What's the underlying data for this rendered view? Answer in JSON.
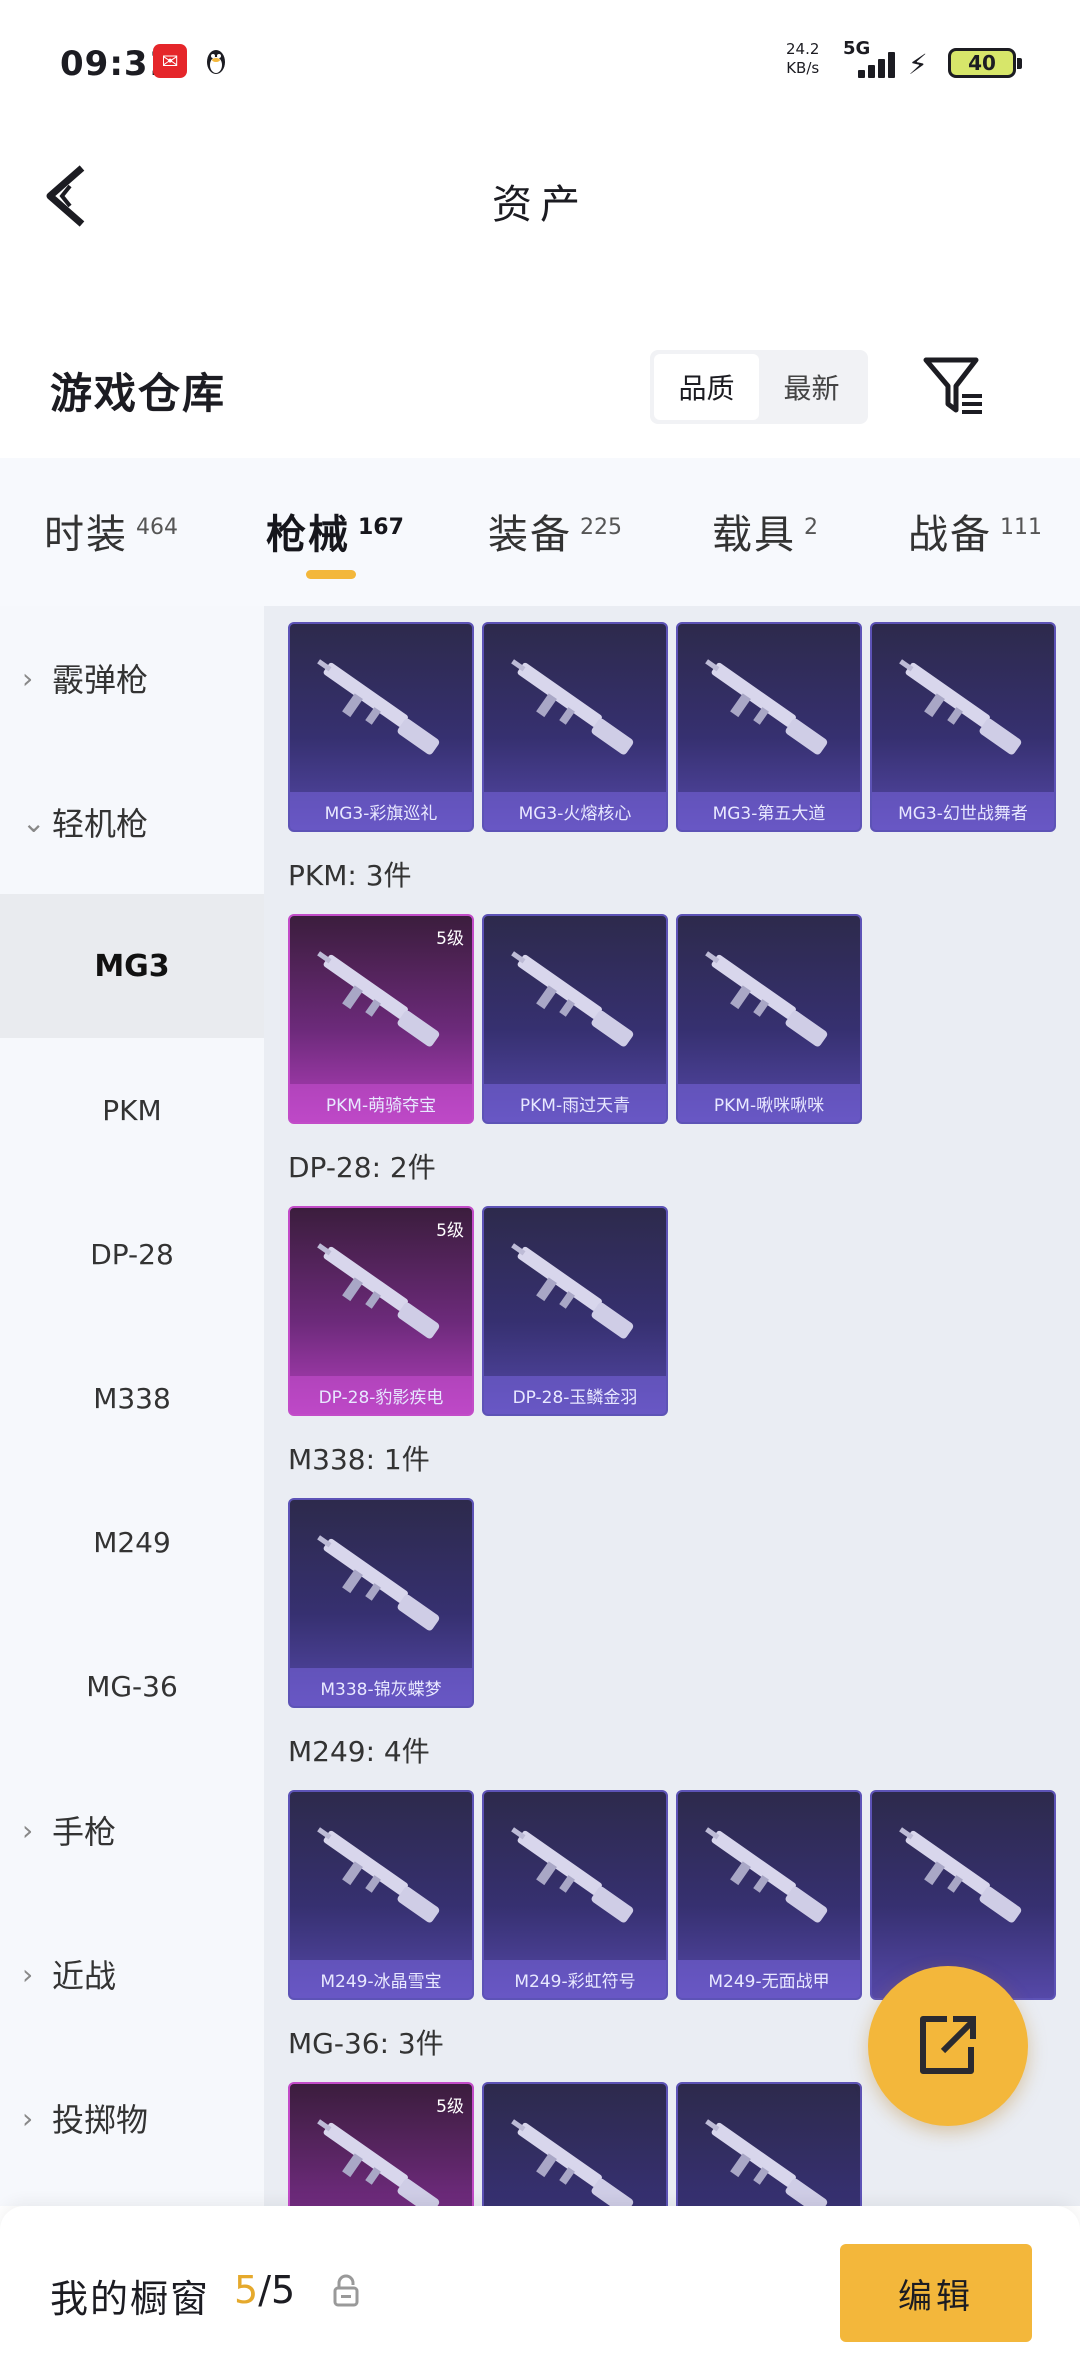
{
  "status_bar": {
    "time": "09:31",
    "speed_value": "24.2",
    "speed_unit": "KB/s",
    "network": "5G",
    "battery": "40"
  },
  "header": {
    "title": "资产"
  },
  "warehouse": {
    "title": "游戏仓库",
    "sort_options": [
      "品质",
      "最新"
    ],
    "active_sort": "品质"
  },
  "tabs": [
    {
      "label": "时装",
      "count": "464"
    },
    {
      "label": "枪械",
      "count": "167"
    },
    {
      "label": "装备",
      "count": "225"
    },
    {
      "label": "载具",
      "count": "2"
    },
    {
      "label": "战备",
      "count": "111"
    }
  ],
  "sidebar": {
    "categories": [
      {
        "label": "霰弹枪",
        "expanded": false
      },
      {
        "label": "轻机枪",
        "expanded": true
      },
      {
        "label": "手枪",
        "expanded": false
      },
      {
        "label": "近战",
        "expanded": false
      },
      {
        "label": "投掷物",
        "expanded": false
      }
    ],
    "sub_items": [
      "MG3",
      "PKM",
      "DP-28",
      "M338",
      "M249",
      "MG-36"
    ],
    "active_sub": "MG3"
  },
  "groups": [
    {
      "title": "",
      "items": [
        {
          "name": "MG3-彩旗巡礼",
          "tier": "",
          "rarity": "purple"
        },
        {
          "name": "MG3-火熔核心",
          "tier": "",
          "rarity": "purple"
        },
        {
          "name": "MG3-第五大道",
          "tier": "",
          "rarity": "purple"
        },
        {
          "name": "MG3-幻世战舞者",
          "tier": "",
          "rarity": "purple"
        }
      ]
    },
    {
      "title": "PKM: 3件",
      "items": [
        {
          "name": "PKM-萌骑夺宝",
          "tier": "5级",
          "rarity": "gold"
        },
        {
          "name": "PKM-雨过天青",
          "tier": "",
          "rarity": "purple"
        },
        {
          "name": "PKM-啾咪啾咪",
          "tier": "",
          "rarity": "purple"
        }
      ]
    },
    {
      "title": "DP-28: 2件",
      "items": [
        {
          "name": "DP-28-豹影疾电",
          "tier": "5级",
          "rarity": "gold"
        },
        {
          "name": "DP-28-玉鳞金羽",
          "tier": "",
          "rarity": "purple"
        }
      ]
    },
    {
      "title": "M338: 1件",
      "items": [
        {
          "name": "M338-锦灰蝶梦",
          "tier": "",
          "rarity": "purple"
        }
      ]
    },
    {
      "title": "M249: 4件",
      "items": [
        {
          "name": "M249-冰晶雪宝",
          "tier": "",
          "rarity": "purple"
        },
        {
          "name": "M249-彩虹符号",
          "tier": "",
          "rarity": "purple"
        },
        {
          "name": "M249-无面战甲",
          "tier": "",
          "rarity": "purple"
        },
        {
          "name": "",
          "tier": "",
          "rarity": "purple"
        }
      ]
    },
    {
      "title": "MG-36: 3件",
      "items": [
        {
          "name": "",
          "tier": "5级",
          "rarity": "gold"
        },
        {
          "name": "",
          "tier": "",
          "rarity": "purple"
        },
        {
          "name": "",
          "tier": "",
          "rarity": "purple"
        }
      ]
    }
  ],
  "bottom_bar": {
    "label": "我的橱窗",
    "current": "5",
    "total": "/5",
    "edit_label": "编辑"
  },
  "colors": {
    "accent": "#f3b73b",
    "purple_card": "#363070",
    "gold_card": "#b23fbb"
  }
}
